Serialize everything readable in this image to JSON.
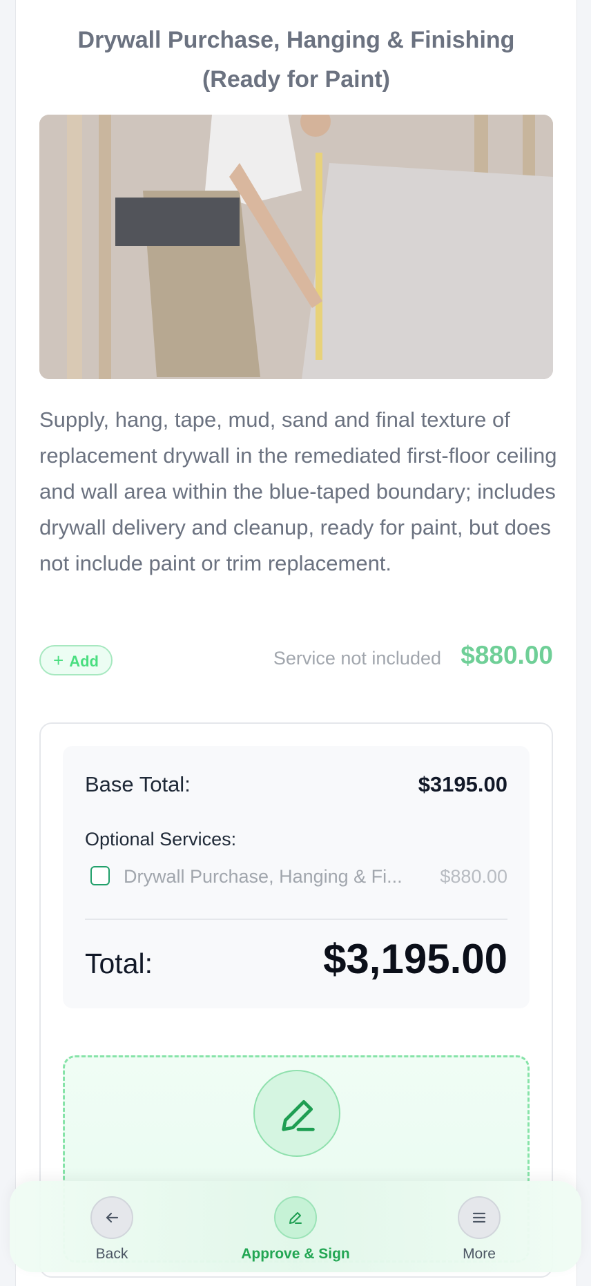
{
  "service": {
    "title": "Drywall Purchase, Hanging & Finishing (Ready for Paint)",
    "description": "Supply, hang, tape, mud, sand and final texture of replacement drywall in the remediated first-floor ceiling and wall area within the blue-taped boundary; includes drywall delivery and cleanup, ready for paint, but does not include paint or trim replacement.",
    "add_label": "Add",
    "status_text": "Service not included",
    "price": "$880.00"
  },
  "summary": {
    "base_total_label": "Base Total:",
    "base_total_value": "$3195.00",
    "optional_label": "Optional Services:",
    "optional_items": [
      {
        "name": "Drywall Purchase, Hanging & Fi...",
        "price": "$880.00",
        "checked": false
      }
    ],
    "total_label": "Total:",
    "total_value": "$3,195.00"
  },
  "nav": {
    "back": "Back",
    "approve": "Approve & Sign",
    "more": "More"
  },
  "colors": {
    "accent": "#22a653",
    "price_green": "#6fcf97"
  }
}
